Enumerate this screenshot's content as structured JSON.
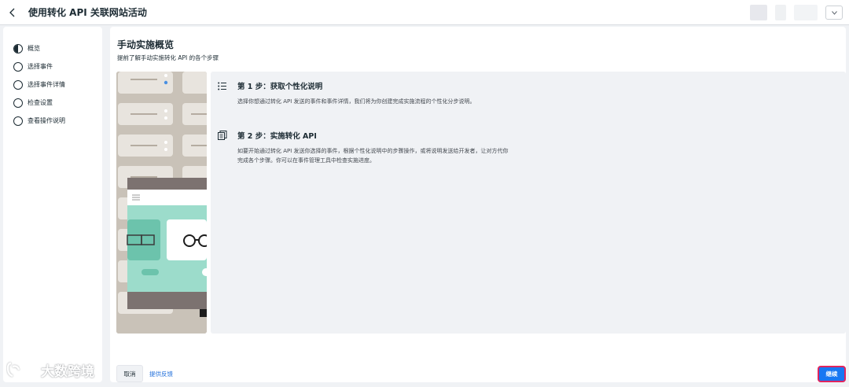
{
  "header": {
    "title": "使用转化 API 关联网站活动",
    "back_icon": "chevron-left-icon"
  },
  "sidebar": {
    "items": [
      {
        "label": "概览",
        "state": "current"
      },
      {
        "label": "选择事件",
        "state": "pending"
      },
      {
        "label": "选择事件详情",
        "state": "pending"
      },
      {
        "label": "检查设置",
        "state": "pending"
      },
      {
        "label": "查看操作说明",
        "state": "pending"
      }
    ]
  },
  "main": {
    "title": "手动实施概览",
    "subtitle": "提前了解手动实施转化 API 的各个步骤",
    "steps": [
      {
        "icon": "list-icon",
        "heading": "第 1 步：获取个性化说明",
        "body": "选择你想通过转化 API 发送的事件和事件详情，我们将为你创建完成实施流程的个性化分步说明。"
      },
      {
        "icon": "document-stack-icon",
        "heading": "第 2 步：实施转化 API",
        "body": "如要开始通过转化 API 发送你选择的事件，根据个性化说明中的步骤操作，或将说明发送给开发者，让对方代你完成各个步骤。你可以在事件管理工具中检查实施进度。"
      }
    ]
  },
  "footer": {
    "cancel_label": "取消",
    "feedback_label": "提供反馈",
    "continue_label": "继续"
  },
  "watermark": {
    "text": "大数跨境"
  },
  "colors": {
    "primary": "#1877f2",
    "highlight_border": "#e0245e",
    "link": "#216fdb",
    "page_bg": "#f0f2f5",
    "illustration_teal": "#9cdccb"
  }
}
